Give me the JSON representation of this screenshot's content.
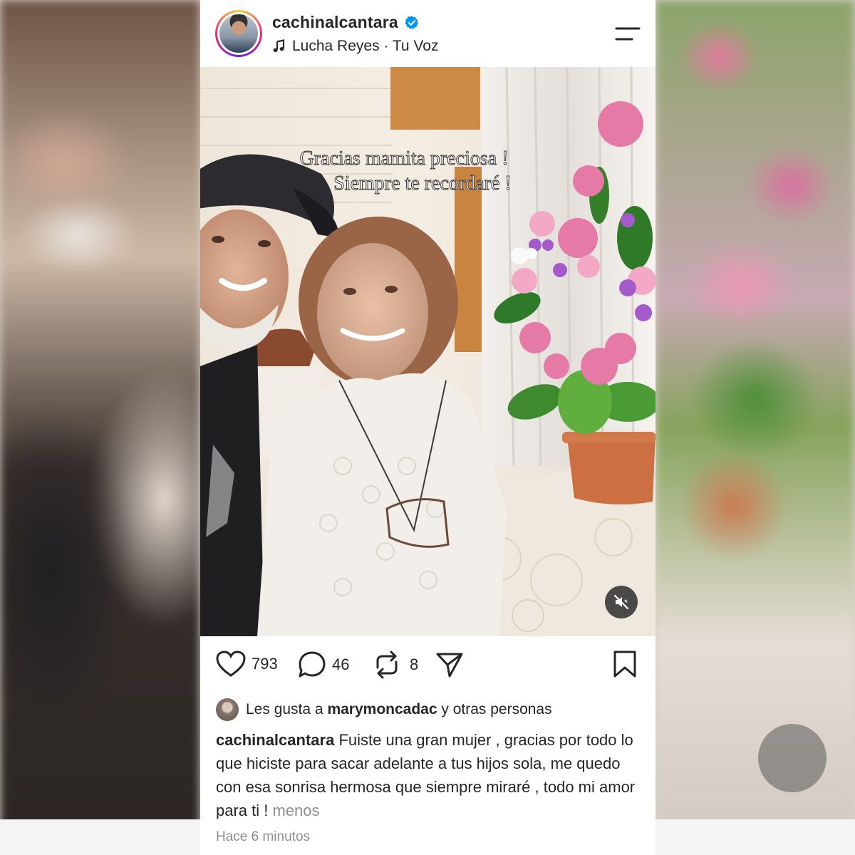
{
  "post": {
    "username": "cachinalcantara",
    "verified": true,
    "audio": "Lucha Reyes · Tu Voz",
    "overlay_line1": "Gracias mamita preciosa !",
    "overlay_line2": "Siempre te recordaré !",
    "likes_count": "793",
    "comments_count": "46",
    "reposts_count": "8",
    "liked_by_prefix": "Les gusta a",
    "liked_by_user": "marymoncadac",
    "liked_by_suffix": "y otras personas",
    "caption_user": "cachinalcantara",
    "caption_text": "Fuiste una gran mujer , gracias por todo lo que hiciste para sacar adelante a tus hijos sola, me quedo con esa sonrisa hermosa que siempre miraré , todo mi amor para ti !",
    "less_label": "menos",
    "timestamp": "Hace 6 minutos"
  },
  "icons": {
    "verified": "verified-badge-icon",
    "music": "music-note-icon",
    "menu": "menu-icon",
    "like": "heart-icon",
    "comment": "comment-icon",
    "repost": "repost-icon",
    "share": "send-icon",
    "save": "bookmark-icon",
    "mute": "muted-speaker-icon"
  },
  "colors": {
    "verified_blue": "#0095f6",
    "text": "#262626",
    "muted_text": "#8e8e8e"
  }
}
